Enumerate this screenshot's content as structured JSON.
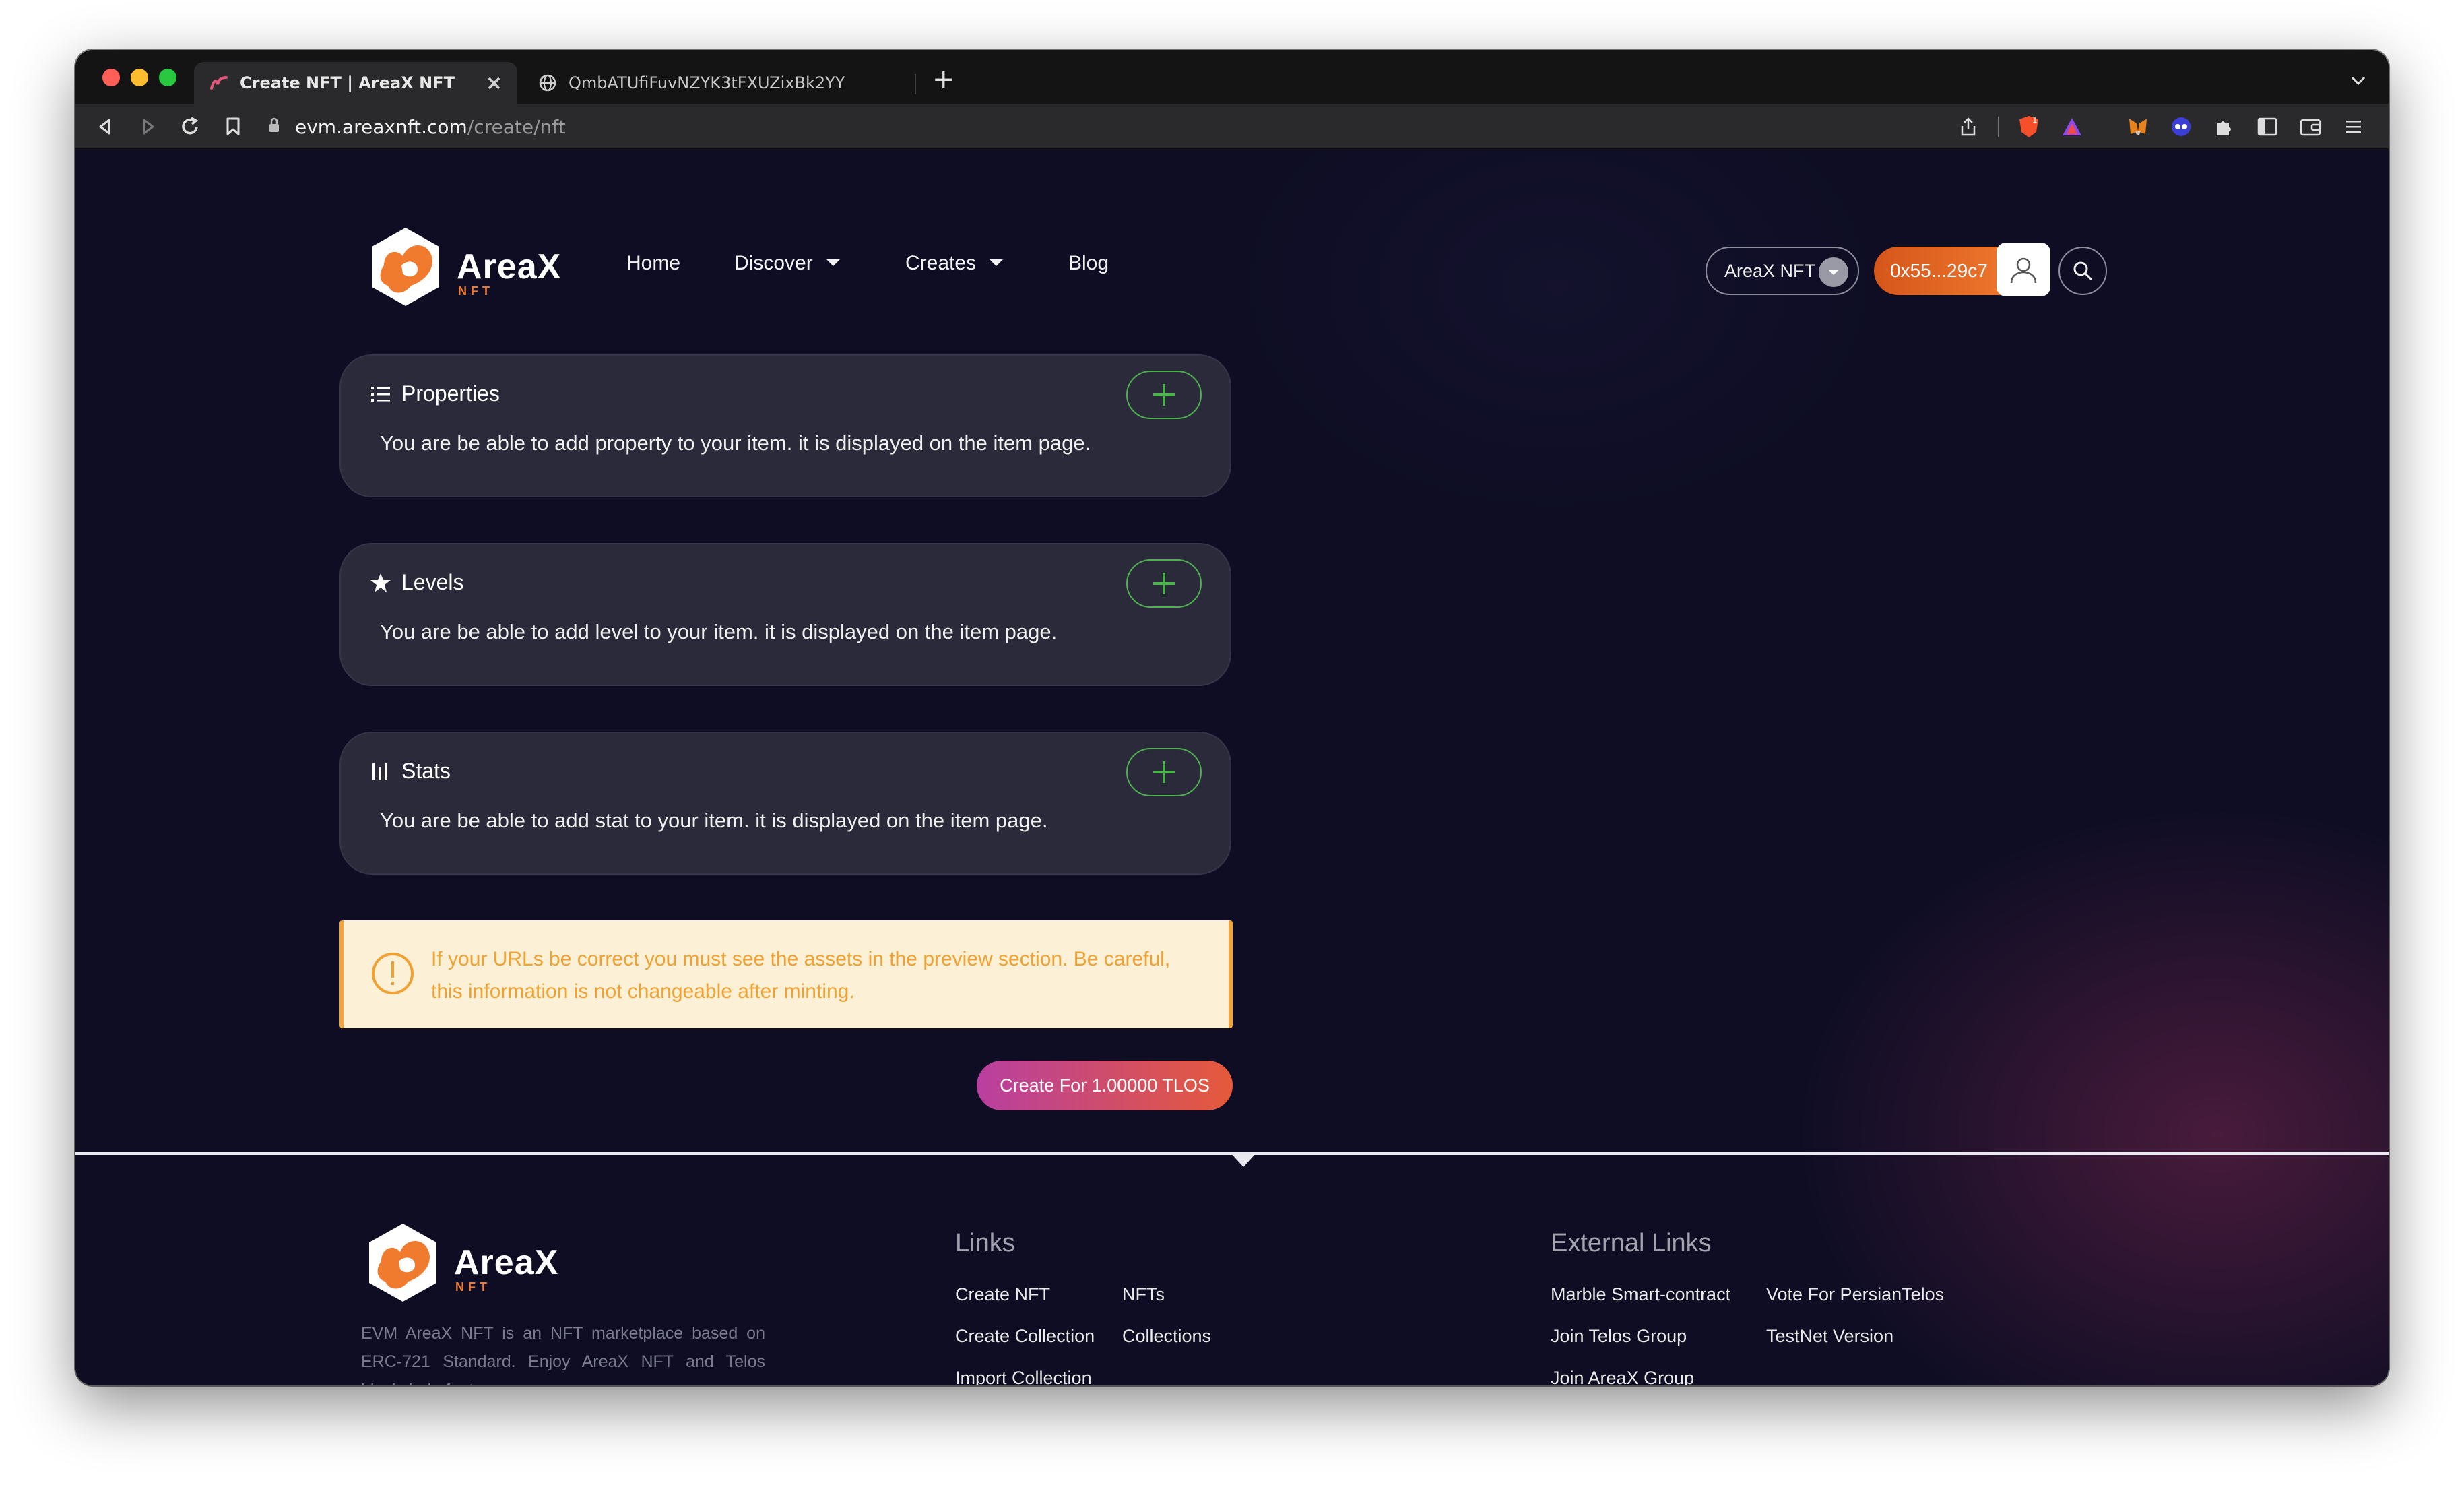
{
  "browser": {
    "tabs": [
      {
        "title": "Create NFT | AreaX NFT",
        "active": true
      },
      {
        "title": "QmbATUfiFuvNZYK3tFXUZixBk2YY",
        "active": false
      }
    ],
    "url_host": "evm.areaxnft.com",
    "url_path": "/create/nft"
  },
  "header": {
    "logo_title": "AreaX",
    "logo_sub": "NFT",
    "nav": {
      "home": "Home",
      "discover": "Discover",
      "creates": "Creates",
      "blog": "Blog"
    },
    "network": "AreaX NFT",
    "wallet": "0x55...29c7"
  },
  "cards": {
    "properties": {
      "title": "Properties",
      "desc": "You are be able to add property to your item. it is displayed on the item page."
    },
    "levels": {
      "title": "Levels",
      "desc": "You are be able to add level to your item. it is displayed on the item page."
    },
    "stats": {
      "title": "Stats",
      "desc": "You are be able to add stat to your item. it is displayed on the item page."
    }
  },
  "alert": {
    "text": "If your URLs be correct you must see the assets in the preview section. Be careful, this information is not changeable after minting."
  },
  "create_button": "Create For 1.00000 TLOS",
  "footer": {
    "logo_title": "AreaX",
    "logo_sub": "NFT",
    "description": "EVM AreaX NFT is an NFT marketplace based on ERC-721 Standard. Enjoy AreaX NFT and Telos blockchain features",
    "links_heading": "Links",
    "links": {
      "create_nft": "Create NFT",
      "nfts": "NFTs",
      "create_collection": "Create Collection",
      "collections": "Collections",
      "import_collection": "Import Collection"
    },
    "external_heading": "External Links",
    "external": {
      "marble": "Marble Smart-contract",
      "vote": "Vote For PersianTelos",
      "telos_group": "Join Telos Group",
      "testnet": "TestNet Version",
      "areax_group": "Join AreaX Group"
    }
  },
  "colors": {
    "accent_orange": "#f07a2e",
    "add_green": "#4fb04f",
    "warning_amber": "#f0a132",
    "page_bg": "#0e0d24"
  }
}
